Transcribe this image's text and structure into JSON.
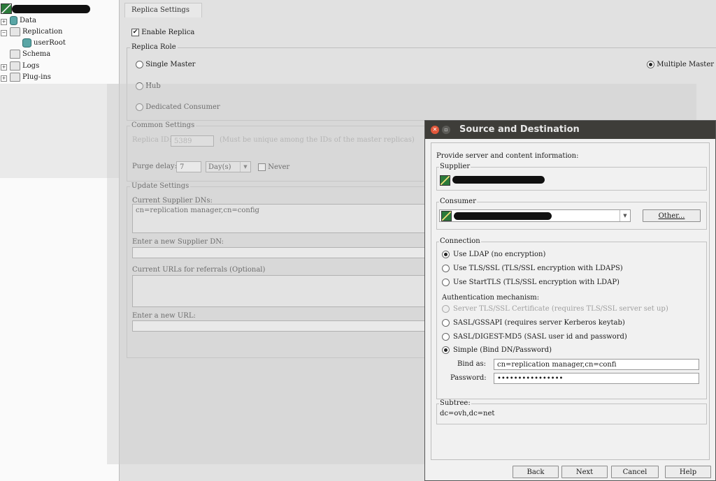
{
  "tree": {
    "items": [
      {
        "label": "Data"
      },
      {
        "label": "Replication"
      },
      {
        "label": "userRoot"
      },
      {
        "label": "Schema"
      },
      {
        "label": "Logs"
      },
      {
        "label": "Plug-ins"
      }
    ]
  },
  "main": {
    "tab": "Replica Settings",
    "enable_replica": {
      "label": "Enable Replica",
      "checked": true
    },
    "replica_role": {
      "title": "Replica Role",
      "single_master": "Single Master",
      "multiple_master": "Multiple Master",
      "hub": "Hub",
      "dedicated_consumer": "Dedicated Consumer",
      "selected": "Multiple Master"
    },
    "common": {
      "title": "Common Settings",
      "replica_id_label": "Replica ID:",
      "replica_id_value": "5389",
      "replica_id_hint": "(Must be unique among the IDs of the master replicas)",
      "purge_label": "Purge delay:",
      "purge_value": "7",
      "purge_unit": "Day(s)",
      "never_label": "Never"
    },
    "update": {
      "title": "Update Settings",
      "current_dns_label": "Current Supplier DNs:",
      "current_dns_value": "cn=replication manager,cn=config",
      "new_dn_label": "Enter a new Supplier DN:",
      "urls_label": "Current URLs for referrals (Optional)",
      "new_url_label": "Enter a new URL:"
    }
  },
  "dialog": {
    "title": "Source and Destination",
    "intro": "Provide server and content information:",
    "supplier_label": "Supplier",
    "consumer_label": "Consumer",
    "other_button": "Other...",
    "connection": {
      "title": "Connection",
      "ldap": "Use LDAP (no encryption)",
      "tls": "Use TLS/SSL (TLS/SSL encryption with LDAPS)",
      "starttls": "Use StartTLS (TLS/SSL encryption with LDAP)",
      "selected": "ldap"
    },
    "auth": {
      "title": "Authentication mechanism:",
      "cert": "Server TLS/SSL Certificate (requires TLS/SSL server set up)",
      "gssapi": "SASL/GSSAPI (requires server Kerberos keytab)",
      "digest": "SASL/DIGEST-MD5 (SASL user id and password)",
      "simple": "Simple (Bind DN/Password)",
      "selected": "simple",
      "bind_label": "Bind as:",
      "bind_value": "cn=replication manager,cn=confi",
      "password_label": "Password:",
      "password_value": "••••••••••••••••"
    },
    "subtree": {
      "title": "Subtree:",
      "value": "dc=ovh,dc=net"
    },
    "buttons": {
      "back": "Back",
      "next": "Next",
      "cancel": "Cancel",
      "help": "Help"
    }
  }
}
